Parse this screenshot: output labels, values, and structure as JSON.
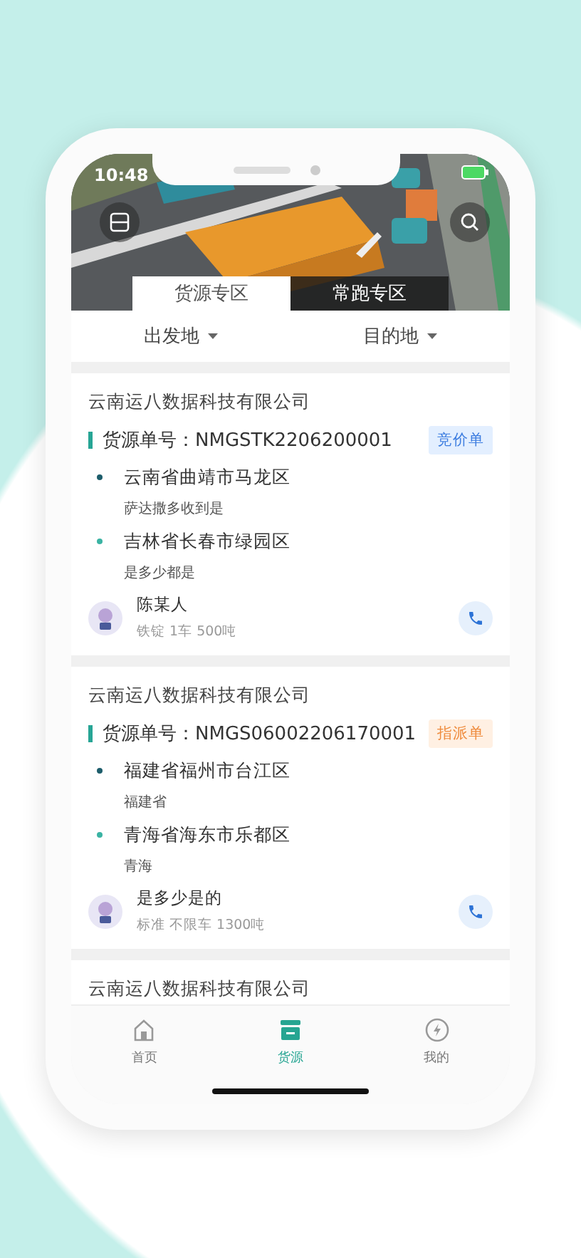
{
  "status_bar": {
    "time": "10:48"
  },
  "tabs": [
    {
      "label": "货源专区",
      "selected": true
    },
    {
      "label": "常跑专区",
      "selected": false
    }
  ],
  "filters": [
    {
      "label": "出发地"
    },
    {
      "label": "目的地"
    }
  ],
  "cards": [
    {
      "company": "云南运八数据科技有限公司",
      "order_label": "货源单号：",
      "order_no": "NMGSTK2206200001",
      "tag": {
        "label": "竞价单",
        "kind": "bid"
      },
      "stops": [
        {
          "kind": "origin",
          "place": "云南省曲靖市马龙区",
          "note": "萨达撒多收到是"
        },
        {
          "kind": "destination",
          "place": "吉林省长春市绿园区",
          "note": "是多少都是"
        }
      ],
      "contact": {
        "name": "陈某人",
        "detail": "铁锭 1车 500吨"
      }
    },
    {
      "company": "云南运八数据科技有限公司",
      "order_label": "货源单号：",
      "order_no": "NMGS06002206170001",
      "tag": {
        "label": "指派单",
        "kind": "assign"
      },
      "stops": [
        {
          "kind": "origin",
          "place": "福建省福州市台江区",
          "note": "福建省"
        },
        {
          "kind": "destination",
          "place": "青海省海东市乐都区",
          "note": "青海"
        }
      ],
      "contact": {
        "name": "是多少是的",
        "detail": "标准 不限车 1300吨"
      }
    },
    {
      "company": "云南运八数据科技有限公司"
    }
  ],
  "nav": [
    {
      "label": "首页",
      "selected": false
    },
    {
      "label": "货源",
      "selected": true
    },
    {
      "label": "我的",
      "selected": false
    }
  ]
}
